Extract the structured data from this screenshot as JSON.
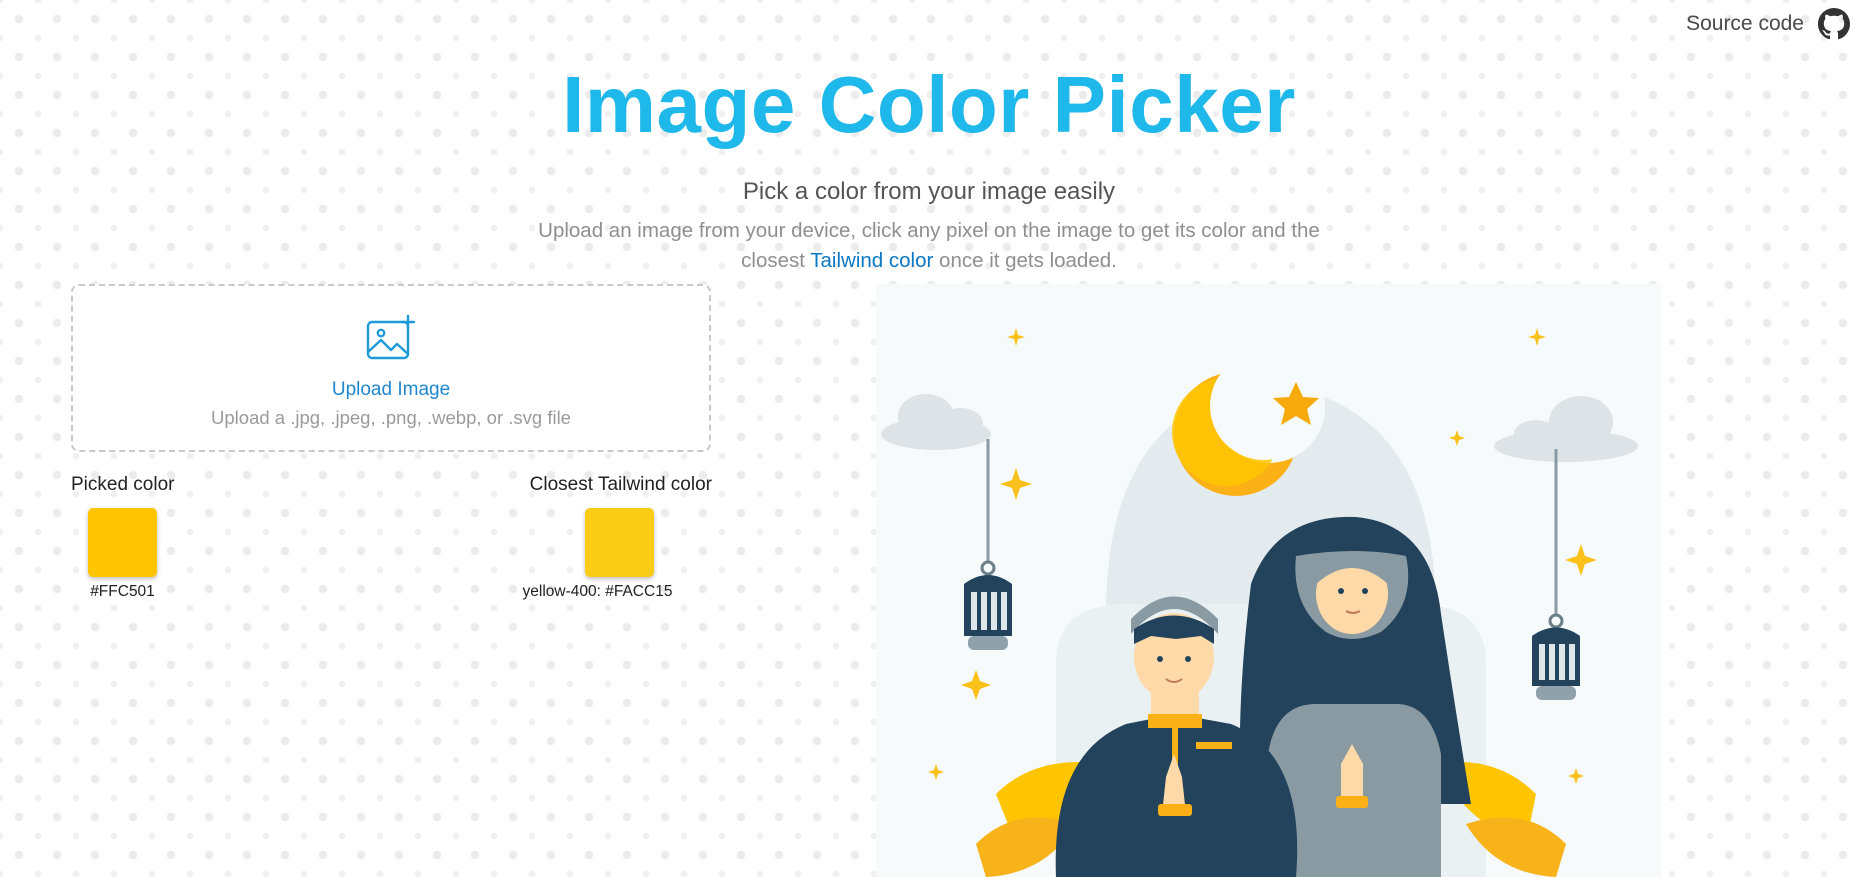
{
  "topbar": {
    "source_label": "Source code",
    "icon": "github-icon"
  },
  "header": {
    "title": "Image Color Picker",
    "subtitle": "Pick a color from your image easily",
    "desc_before": "Upload an image from your device, click any pixel on the image to get its color and the closest ",
    "desc_link": "Tailwind color",
    "desc_after": " once it gets loaded."
  },
  "upload": {
    "icon": "image-add-icon",
    "label": "Upload Image",
    "hint": "Upload a .jpg, .jpeg, .png, .webp, or .svg file"
  },
  "picked": {
    "heading": "Picked color",
    "color": "#FFC501",
    "caption": "#FFC501"
  },
  "closest": {
    "heading": "Closest Tailwind color",
    "color": "#FACC15",
    "caption": "yellow-400: #FACC15"
  },
  "preview": {
    "icon": "uploaded-image"
  },
  "colors": {
    "accent": "#1FB8EA",
    "link": "#0B78C5"
  }
}
